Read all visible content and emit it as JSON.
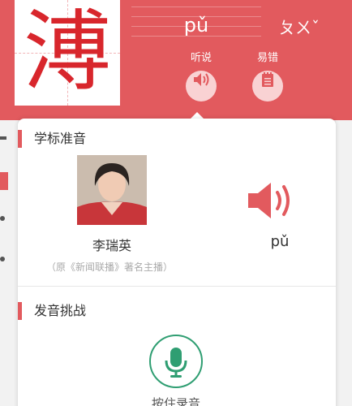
{
  "character": "溥",
  "pinyin": "pǔ",
  "zhuyin": "ㄆㄨˇ",
  "header": {
    "listen_label": "听说",
    "mistakes_label": "易错"
  },
  "section_standard": {
    "title": "学标准音",
    "speaker_name": "李瑞英",
    "speaker_note": "（原《新闻联播》著名主播）",
    "pinyin": "pǔ"
  },
  "section_challenge": {
    "title": "发音挑战",
    "record_label": "按住录音"
  },
  "icons": {
    "listen": "speaker-icon",
    "mistakes": "notepad-icon",
    "play": "speaker-icon",
    "record": "microphone-icon"
  },
  "colors": {
    "brand_red": "#e25a5e",
    "character_red": "#d8262c",
    "mic_green": "#2f9e72"
  }
}
